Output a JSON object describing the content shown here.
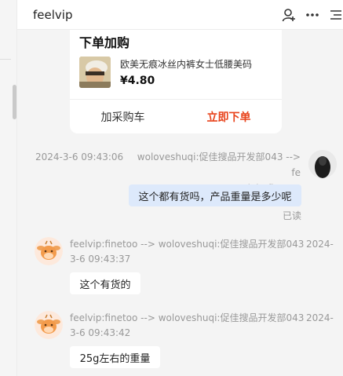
{
  "header": {
    "title": "feelvip",
    "icons": [
      "person-add-icon",
      "more-horizontal-icon",
      "menu-list-icon"
    ]
  },
  "order_card": {
    "title": "下单加购",
    "product_name": "欧美无痕冰丝内裤女士低腰美码",
    "price": "¥4.80",
    "add_cart_label": "加采购车",
    "order_now_label": "立即下单"
  },
  "messages": [
    {
      "timestamp": "2024-3-6 09:43:06",
      "route_line1": "woloveshuqi:促佳搜品开发部043 --> fe",
      "route_line2": "elvip:finetoo",
      "text": "这个都有货吗，产品重量是多少呢",
      "status": "已读"
    },
    {
      "route_line1": "feelvip:finetoo --> woloveshuqi:促佳搜品开发部043",
      "date_part": "2024-",
      "route_line2": "3-6 09:43:37",
      "text": "这个有货的"
    },
    {
      "route_line1": "feelvip:finetoo --> woloveshuqi:促佳搜品开发部043",
      "date_part": "2024-",
      "route_line2": "3-6 09:43:42",
      "text": "25g左右的重量"
    }
  ],
  "colors": {
    "accent_orange": "#e8431b",
    "self_bubble": "#dde9fb",
    "chat_bg": "#f4f4f4"
  }
}
